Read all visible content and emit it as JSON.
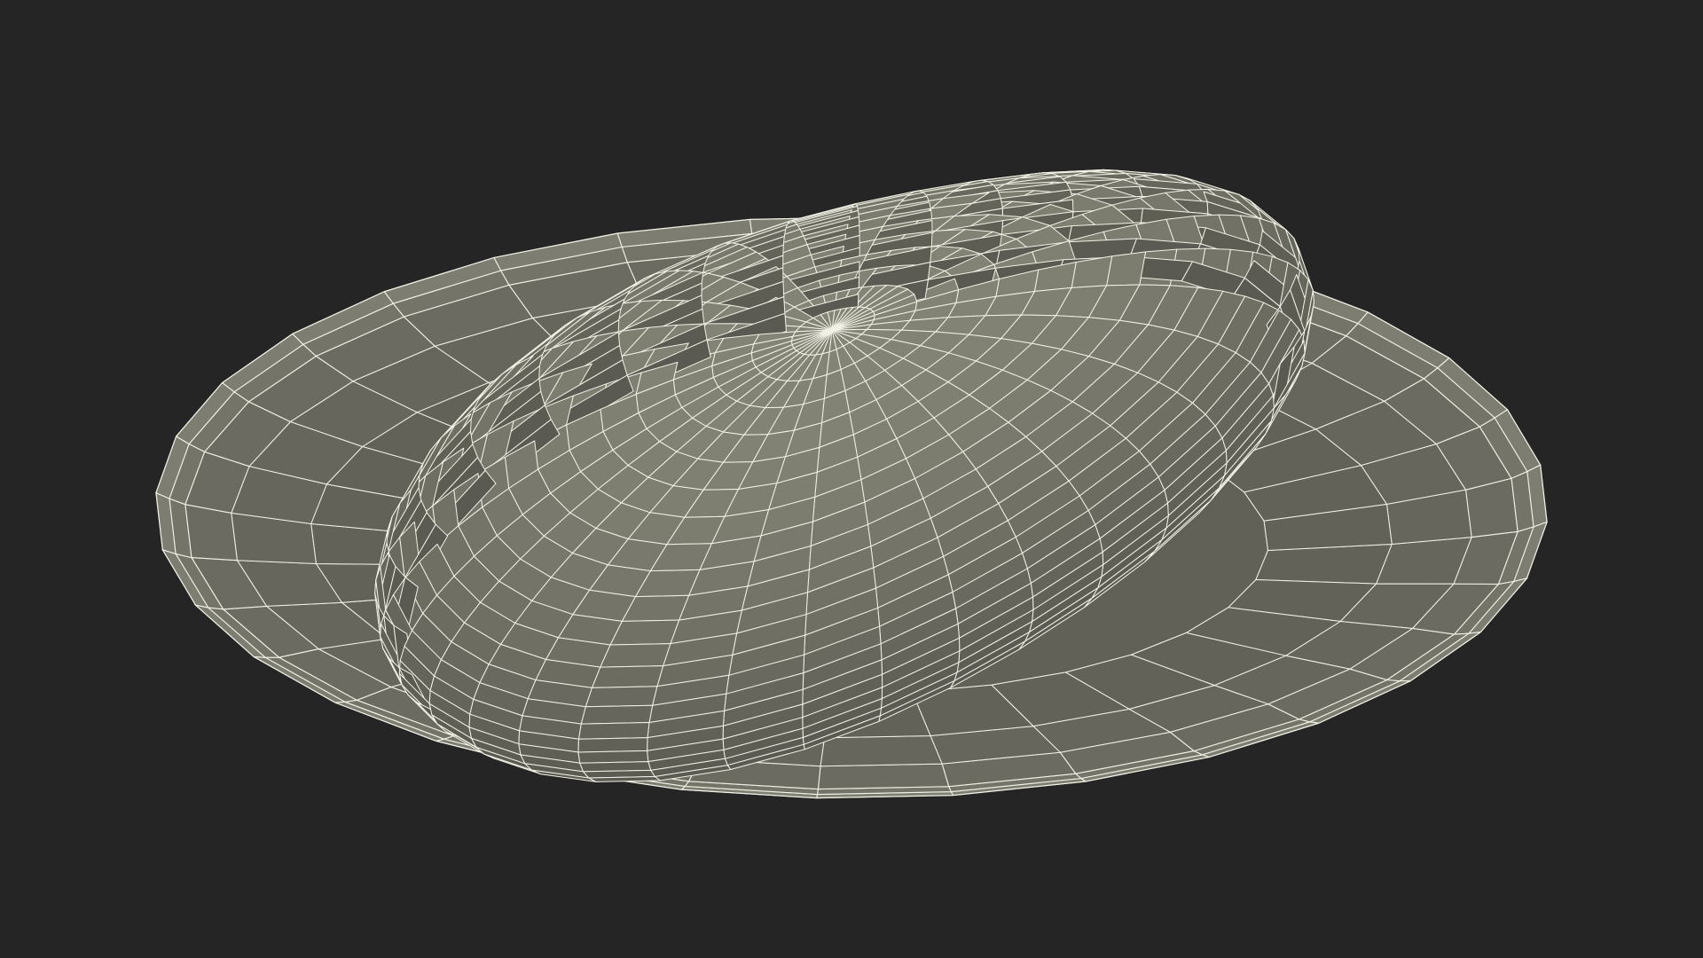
{
  "scene": {
    "subject": "wireframe-render",
    "background_color": "#252525",
    "surface_color": "#747468",
    "surface_shadow_color": "#4e4e46",
    "surface_highlight_color": "#8a8a7d",
    "wire_color": "#f1f1e6",
    "plate_rim_segments": 32,
    "plate_rim_rows": 3,
    "food_u_segments": 34,
    "food_v_segments": 22
  }
}
